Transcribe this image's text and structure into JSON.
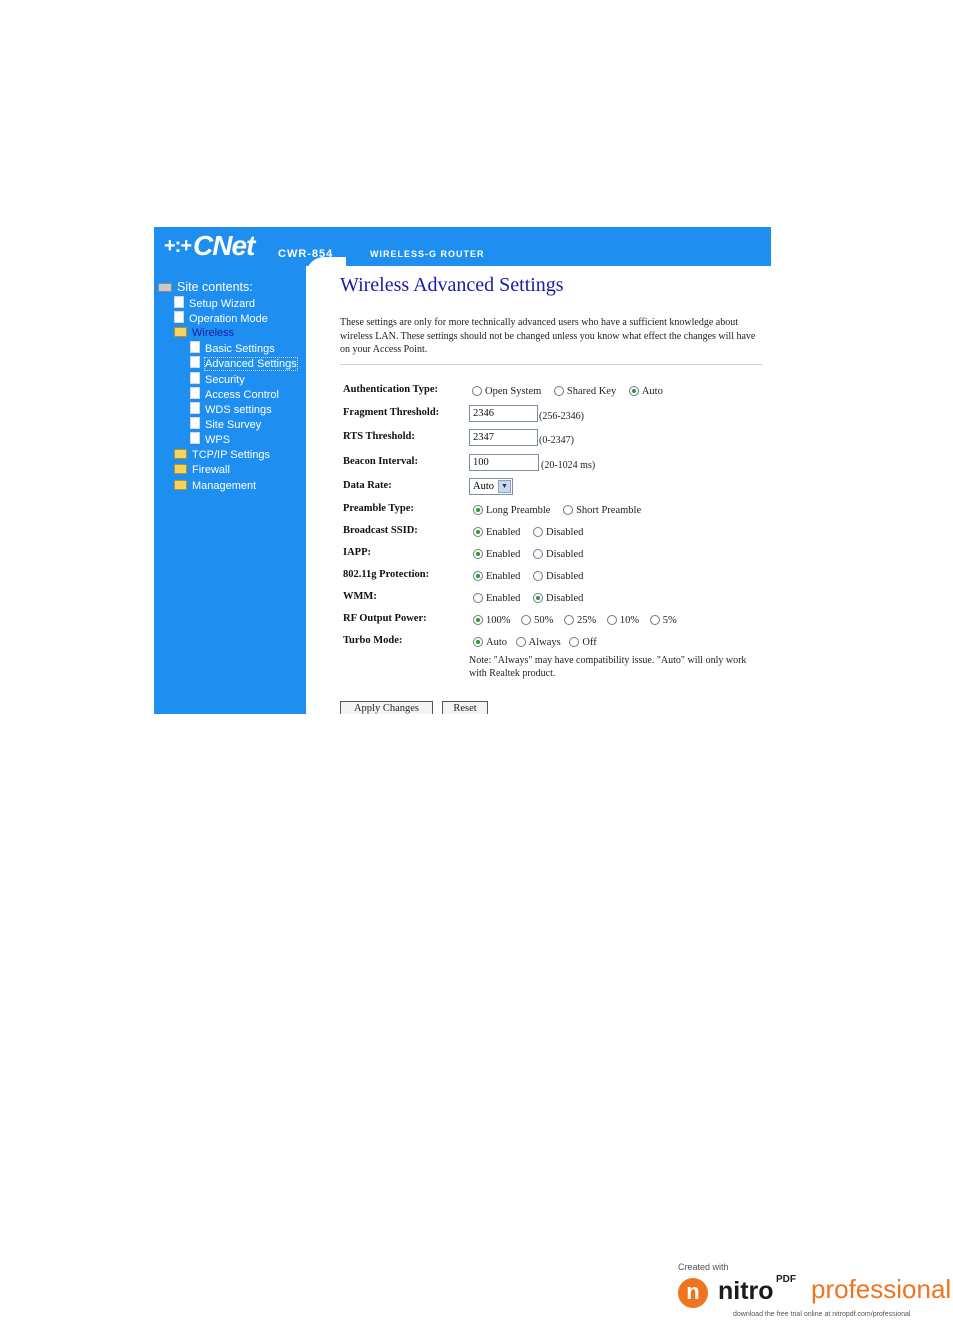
{
  "header": {
    "logo_text": "CNet",
    "logo_mark": "+:+",
    "model": "CWR-854",
    "product": "WIRELESS-G ROUTER"
  },
  "sidebar": {
    "root_label": "Site contents:",
    "items": [
      {
        "label": "Setup Wizard",
        "icon": "document-icon"
      },
      {
        "label": "Operation Mode",
        "icon": "document-icon"
      },
      {
        "label": "Wireless",
        "icon": "folder-open-icon",
        "active": true
      },
      {
        "label": "Basic Settings",
        "icon": "document-icon"
      },
      {
        "label": "Advanced Settings",
        "icon": "document-icon",
        "selected": true
      },
      {
        "label": "Security",
        "icon": "document-icon"
      },
      {
        "label": "Access Control",
        "icon": "document-icon"
      },
      {
        "label": "WDS settings",
        "icon": "document-icon"
      },
      {
        "label": "Site Survey",
        "icon": "document-icon"
      },
      {
        "label": "WPS",
        "icon": "document-icon"
      },
      {
        "label": "TCP/IP Settings",
        "icon": "folder-icon"
      },
      {
        "label": "Firewall",
        "icon": "folder-icon"
      },
      {
        "label": "Management",
        "icon": "folder-icon"
      }
    ]
  },
  "main": {
    "title": "Wireless Advanced Settings",
    "intro": "These settings are only for more technically advanced users who have a sufficient knowledge about wireless LAN. These settings should not be changed unless you know what effect the changes will have on your Access Point.",
    "auth": {
      "label": "Authentication Type:",
      "options": [
        "Open System",
        "Shared Key",
        "Auto"
      ],
      "selected": "Auto"
    },
    "fragment": {
      "label": "Fragment Threshold:",
      "value": "2346",
      "hint": "(256-2346)"
    },
    "rts": {
      "label": "RTS Threshold:",
      "value": "2347",
      "hint": "(0-2347)"
    },
    "beacon": {
      "label": "Beacon Interval:",
      "value": "100",
      "hint": "(20-1024 ms)"
    },
    "data_rate": {
      "label": "Data Rate:",
      "value": "Auto"
    },
    "preamble": {
      "label": "Preamble Type:",
      "options": [
        "Long Preamble",
        "Short Preamble"
      ],
      "selected": "Long Preamble"
    },
    "broadcast_ssid": {
      "label": "Broadcast SSID:",
      "options": [
        "Enabled",
        "Disabled"
      ],
      "selected": "Enabled"
    },
    "iapp": {
      "label": "IAPP:",
      "options": [
        "Enabled",
        "Disabled"
      ],
      "selected": "Enabled"
    },
    "protection": {
      "label": "802.11g Protection:",
      "options": [
        "Enabled",
        "Disabled"
      ],
      "selected": "Enabled"
    },
    "wmm": {
      "label": "WMM:",
      "options": [
        "Enabled",
        "Disabled"
      ],
      "selected": "Disabled"
    },
    "rf_power": {
      "label": "RF Output Power:",
      "options": [
        "100%",
        "50%",
        "25%",
        "10%",
        "5%"
      ],
      "selected": "100%"
    },
    "turbo": {
      "label": "Turbo Mode:",
      "options": [
        "Auto",
        "Always",
        "Off"
      ],
      "selected": "Auto"
    },
    "note": "Note: \"Always\" may have compatibility issue. \"Auto\" will only work with Realtek product.",
    "apply_label": "Apply Changes",
    "reset_label": "Reset"
  },
  "watermark": {
    "created_with": "Created with",
    "brand": "nitro",
    "pdf": "PDF",
    "edition": "professional",
    "tagline": "download the free trial online at nitropdf.com/professional",
    "colors": {
      "orange": "#f0741f"
    }
  },
  "colors": {
    "sidebar_blue": "#1e8ff0",
    "title_blue": "#1a1aa8"
  }
}
